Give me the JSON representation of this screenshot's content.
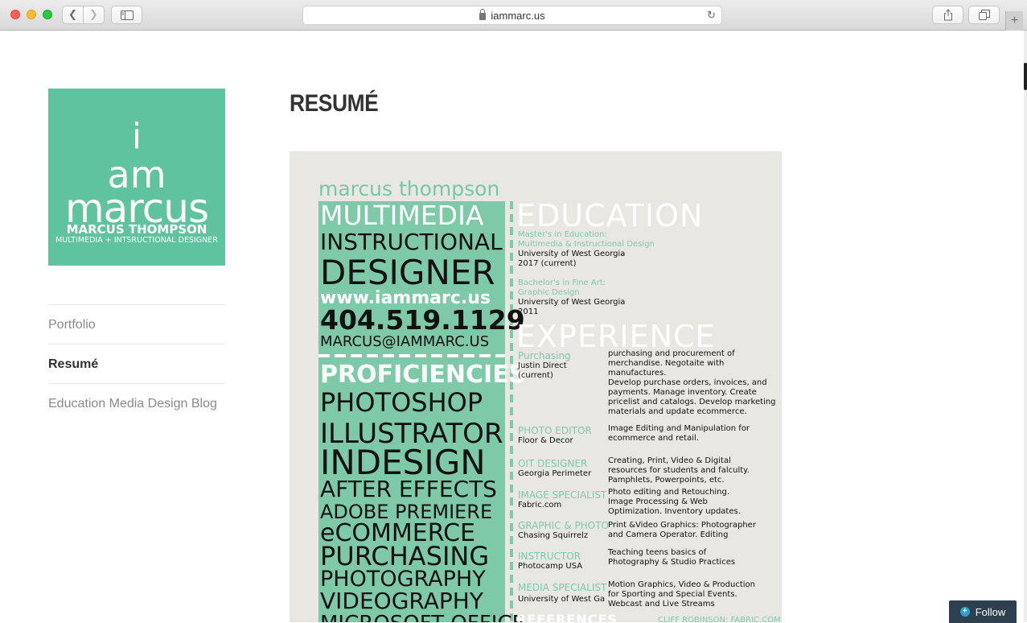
{
  "browser": {
    "url": "iammarc.us",
    "back_glyph": "❮",
    "forward_glyph": "❯",
    "reload_glyph": "↻",
    "newtab_glyph": "+"
  },
  "logo": {
    "line_i": "i",
    "line_am": "am",
    "line_marcus": "marcus",
    "name": "MARCUS THOMPSON",
    "subtitle": "MULTIMEDIA + INTSRUCTIONAL DESIGNER"
  },
  "nav": {
    "items": [
      {
        "label": "Portfolio"
      },
      {
        "label": "Resumé"
      },
      {
        "label": "Education Media Design Blog"
      }
    ]
  },
  "page": {
    "title": "RESUMÉ"
  },
  "resume": {
    "name": "marcus thompson",
    "left": {
      "multimedia": "MULTIMEDIA",
      "instructional": "INSTRUCTIONAL",
      "designer": "DESIGNER",
      "website": "www.iammarc.us",
      "phone": "404.519.1129",
      "email": "MARCUS@IAMMARC.US",
      "proficiencies": "PROFICIENCIES",
      "skills": [
        "PHOTOSHOP",
        "ILLUSTRATOR",
        "INDESIGN",
        "AFTER EFFECTS",
        "ADOBE PREMIERE",
        "eCOMMERCE",
        "PURCHASING",
        "PHOTOGRAPHY",
        "VIDEOGRAPHY",
        "MICROSOFT OFFICE"
      ]
    },
    "education": {
      "heading": "EDUCATION",
      "items": [
        {
          "degree_1": "Master's in Education:",
          "degree_2": "Multimedia & Instructional Design",
          "school": "University of West Georgia",
          "year": "2017 (current)"
        },
        {
          "degree_1": "Bachelor's in Fine Art:",
          "degree_2": "Graphic Design",
          "school": "University of West Georgia",
          "year": "2011"
        }
      ]
    },
    "experience": {
      "heading": "EXPERIENCE",
      "jobs": [
        {
          "title": "Purchasing",
          "company": "Justin Direct",
          "company_2": "(current)",
          "desc": "purchasing and procurement of\nmerchandise. Negotaite with manufactures.\nDevelop purchase orders, invoices, and\npayments. Manage inventory. Create\npricelist and catalogs. Develop marketing\nmaterials and update ecommerce."
        },
        {
          "title": "PHOTO EDITOR",
          "company": "Floor & Decor",
          "desc": "Image Editing and Manipulation for\necommerce and retail."
        },
        {
          "title": "OIT DESIGNER",
          "company": "Georgia Perimeter",
          "desc": "Creating, Print, Video & Digital\nresources for students and falculty.\nPamphlets, Powerpoints, etc."
        },
        {
          "title": "IMAGE SPECIALIST",
          "company": "Fabric.com",
          "desc": "Photo editing and Retouching.\nImage Processing & Web\nOptimization. Inventory updates."
        },
        {
          "title": "GRAPHIC & PHOTO",
          "company": "Chasing Squirrelz",
          "desc": "Print &Video Graphics: Photographer\nand Camera Operator. Editing"
        },
        {
          "title": "INSTRUCTOR",
          "company": "Photocamp USA",
          "desc": "Teaching teens basics of\nPhotography & Studio Practices"
        },
        {
          "title": "MEDIA SPECIALIST",
          "company": "University of West Ga",
          "desc": "Motion Graphics, Video & Production\nfor Sporting and Special Events.\nWebcast and Live Streams"
        }
      ]
    },
    "references": {
      "heading": "REFERENCES",
      "first": "CLIFF ROBINSON: FABRIC.COM"
    }
  },
  "follow": {
    "label": "Follow"
  }
}
